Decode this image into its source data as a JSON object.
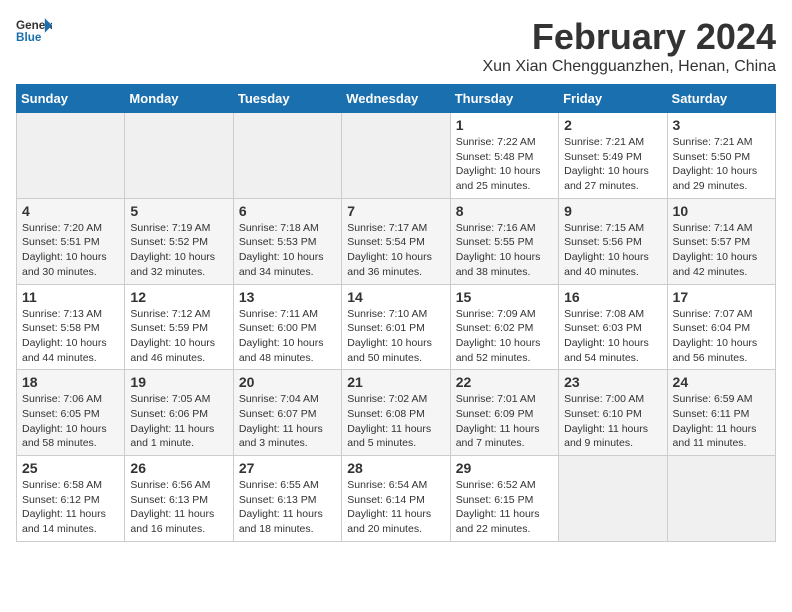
{
  "header": {
    "logo_line1": "General",
    "logo_line2": "Blue",
    "month": "February 2024",
    "location": "Xun Xian Chengguanzhen, Henan, China"
  },
  "weekdays": [
    "Sunday",
    "Monday",
    "Tuesday",
    "Wednesday",
    "Thursday",
    "Friday",
    "Saturday"
  ],
  "weeks": [
    [
      {
        "day": "",
        "info": ""
      },
      {
        "day": "",
        "info": ""
      },
      {
        "day": "",
        "info": ""
      },
      {
        "day": "",
        "info": ""
      },
      {
        "day": "1",
        "info": "Sunrise: 7:22 AM\nSunset: 5:48 PM\nDaylight: 10 hours\nand 25 minutes."
      },
      {
        "day": "2",
        "info": "Sunrise: 7:21 AM\nSunset: 5:49 PM\nDaylight: 10 hours\nand 27 minutes."
      },
      {
        "day": "3",
        "info": "Sunrise: 7:21 AM\nSunset: 5:50 PM\nDaylight: 10 hours\nand 29 minutes."
      }
    ],
    [
      {
        "day": "4",
        "info": "Sunrise: 7:20 AM\nSunset: 5:51 PM\nDaylight: 10 hours\nand 30 minutes."
      },
      {
        "day": "5",
        "info": "Sunrise: 7:19 AM\nSunset: 5:52 PM\nDaylight: 10 hours\nand 32 minutes."
      },
      {
        "day": "6",
        "info": "Sunrise: 7:18 AM\nSunset: 5:53 PM\nDaylight: 10 hours\nand 34 minutes."
      },
      {
        "day": "7",
        "info": "Sunrise: 7:17 AM\nSunset: 5:54 PM\nDaylight: 10 hours\nand 36 minutes."
      },
      {
        "day": "8",
        "info": "Sunrise: 7:16 AM\nSunset: 5:55 PM\nDaylight: 10 hours\nand 38 minutes."
      },
      {
        "day": "9",
        "info": "Sunrise: 7:15 AM\nSunset: 5:56 PM\nDaylight: 10 hours\nand 40 minutes."
      },
      {
        "day": "10",
        "info": "Sunrise: 7:14 AM\nSunset: 5:57 PM\nDaylight: 10 hours\nand 42 minutes."
      }
    ],
    [
      {
        "day": "11",
        "info": "Sunrise: 7:13 AM\nSunset: 5:58 PM\nDaylight: 10 hours\nand 44 minutes."
      },
      {
        "day": "12",
        "info": "Sunrise: 7:12 AM\nSunset: 5:59 PM\nDaylight: 10 hours\nand 46 minutes."
      },
      {
        "day": "13",
        "info": "Sunrise: 7:11 AM\nSunset: 6:00 PM\nDaylight: 10 hours\nand 48 minutes."
      },
      {
        "day": "14",
        "info": "Sunrise: 7:10 AM\nSunset: 6:01 PM\nDaylight: 10 hours\nand 50 minutes."
      },
      {
        "day": "15",
        "info": "Sunrise: 7:09 AM\nSunset: 6:02 PM\nDaylight: 10 hours\nand 52 minutes."
      },
      {
        "day": "16",
        "info": "Sunrise: 7:08 AM\nSunset: 6:03 PM\nDaylight: 10 hours\nand 54 minutes."
      },
      {
        "day": "17",
        "info": "Sunrise: 7:07 AM\nSunset: 6:04 PM\nDaylight: 10 hours\nand 56 minutes."
      }
    ],
    [
      {
        "day": "18",
        "info": "Sunrise: 7:06 AM\nSunset: 6:05 PM\nDaylight: 10 hours\nand 58 minutes."
      },
      {
        "day": "19",
        "info": "Sunrise: 7:05 AM\nSunset: 6:06 PM\nDaylight: 11 hours\nand 1 minute."
      },
      {
        "day": "20",
        "info": "Sunrise: 7:04 AM\nSunset: 6:07 PM\nDaylight: 11 hours\nand 3 minutes."
      },
      {
        "day": "21",
        "info": "Sunrise: 7:02 AM\nSunset: 6:08 PM\nDaylight: 11 hours\nand 5 minutes."
      },
      {
        "day": "22",
        "info": "Sunrise: 7:01 AM\nSunset: 6:09 PM\nDaylight: 11 hours\nand 7 minutes."
      },
      {
        "day": "23",
        "info": "Sunrise: 7:00 AM\nSunset: 6:10 PM\nDaylight: 11 hours\nand 9 minutes."
      },
      {
        "day": "24",
        "info": "Sunrise: 6:59 AM\nSunset: 6:11 PM\nDaylight: 11 hours\nand 11 minutes."
      }
    ],
    [
      {
        "day": "25",
        "info": "Sunrise: 6:58 AM\nSunset: 6:12 PM\nDaylight: 11 hours\nand 14 minutes."
      },
      {
        "day": "26",
        "info": "Sunrise: 6:56 AM\nSunset: 6:13 PM\nDaylight: 11 hours\nand 16 minutes."
      },
      {
        "day": "27",
        "info": "Sunrise: 6:55 AM\nSunset: 6:13 PM\nDaylight: 11 hours\nand 18 minutes."
      },
      {
        "day": "28",
        "info": "Sunrise: 6:54 AM\nSunset: 6:14 PM\nDaylight: 11 hours\nand 20 minutes."
      },
      {
        "day": "29",
        "info": "Sunrise: 6:52 AM\nSunset: 6:15 PM\nDaylight: 11 hours\nand 22 minutes."
      },
      {
        "day": "",
        "info": ""
      },
      {
        "day": "",
        "info": ""
      }
    ]
  ]
}
